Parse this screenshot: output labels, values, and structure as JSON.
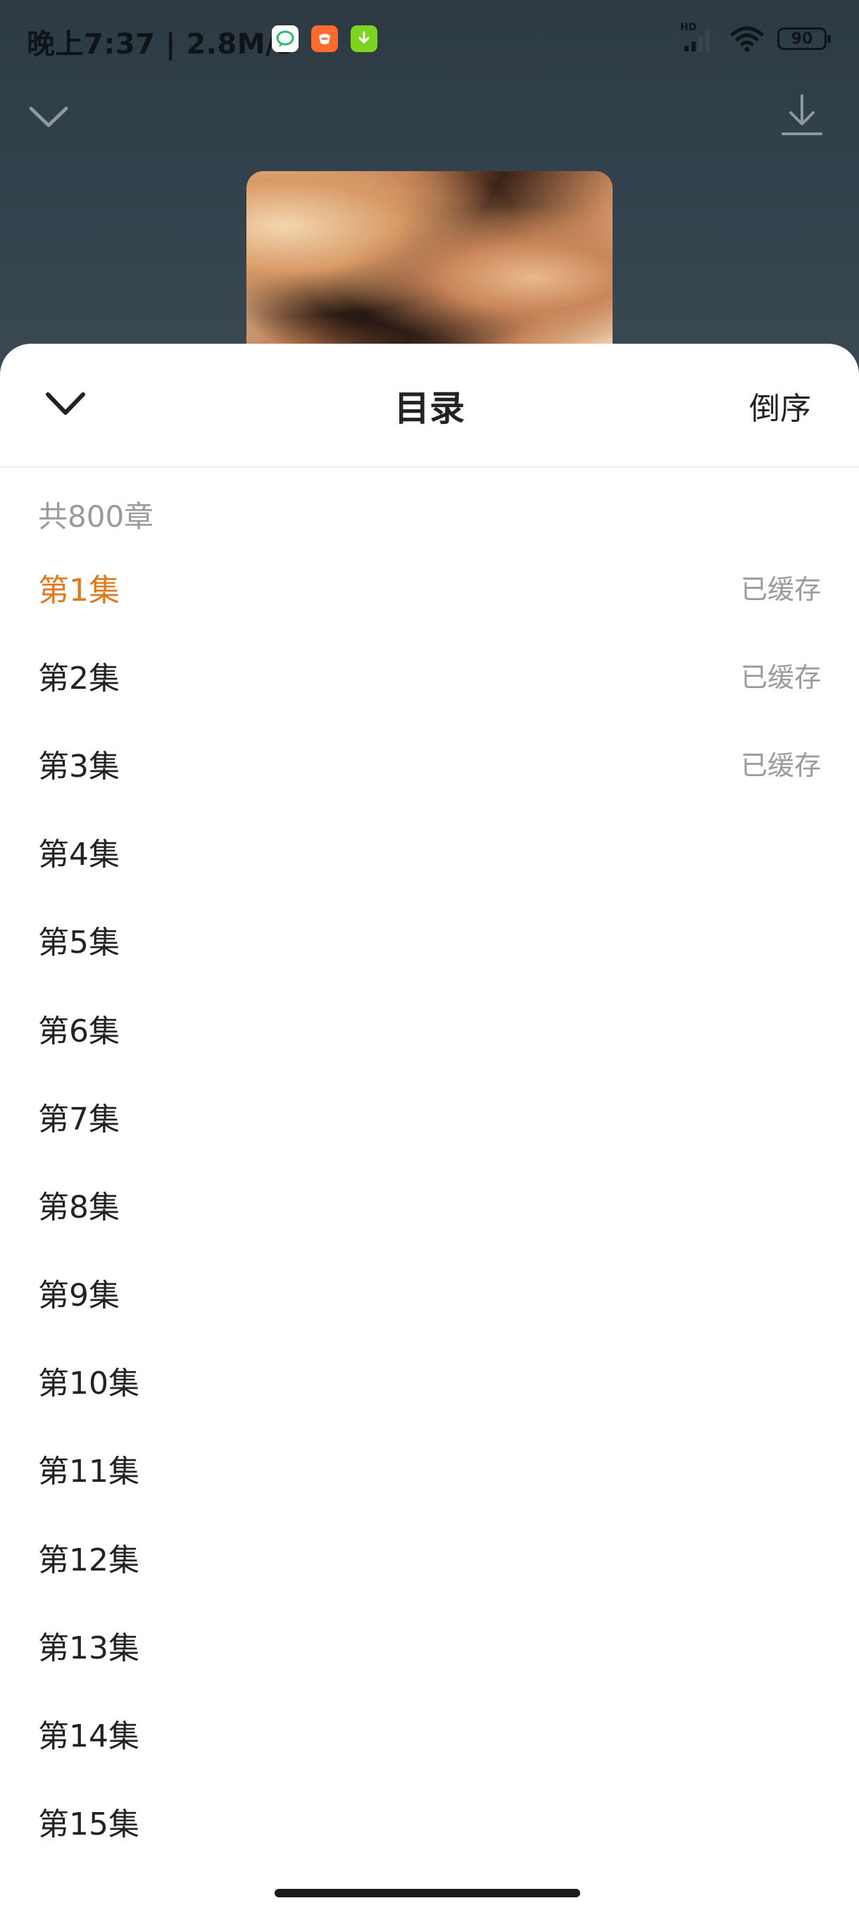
{
  "status_bar": {
    "time_speed": "晚上7:37 | 2.8M/s",
    "hd_label": "HD",
    "battery_level": "90",
    "app_icons": [
      "chat-bubble-icon",
      "orange-app-icon",
      "green-download-icon"
    ],
    "app_colors": [
      "#ffffff",
      "#ff6a2f",
      "#7ed321"
    ]
  },
  "background": {
    "collapse_icon": "chevron-down-icon",
    "download_icon": "download-icon"
  },
  "sheet": {
    "title": "目录",
    "sort_label": "倒序",
    "close_icon": "chevron-down-icon",
    "count_label": "共800章",
    "accent_color": "#de7a1f",
    "chapters": [
      {
        "title": "第1集",
        "status": "已缓存",
        "current": true
      },
      {
        "title": "第2集",
        "status": "已缓存"
      },
      {
        "title": "第3集",
        "status": "已缓存"
      },
      {
        "title": "第4集",
        "status": ""
      },
      {
        "title": "第5集",
        "status": ""
      },
      {
        "title": "第6集",
        "status": ""
      },
      {
        "title": "第7集",
        "status": ""
      },
      {
        "title": "第8集",
        "status": ""
      },
      {
        "title": "第9集",
        "status": ""
      },
      {
        "title": "第10集",
        "status": ""
      },
      {
        "title": "第11集",
        "status": ""
      },
      {
        "title": "第12集",
        "status": ""
      },
      {
        "title": "第13集",
        "status": ""
      },
      {
        "title": "第14集",
        "status": ""
      },
      {
        "title": "第15集",
        "status": ""
      }
    ]
  }
}
